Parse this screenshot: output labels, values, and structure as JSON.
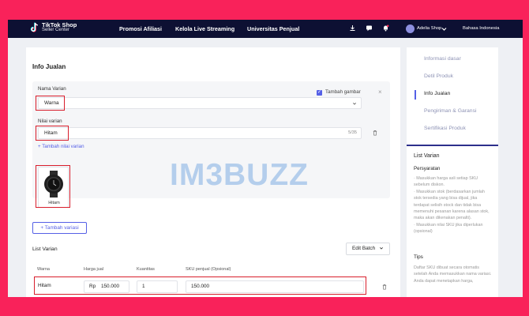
{
  "topbar": {
    "logo_line1": "TikTok Shop",
    "logo_line2": "Seller Center",
    "nav": [
      "Promosi Afiliasi",
      "Kelola Live Streaming",
      "Universitas Penjual"
    ],
    "shop_name": "Adelia Shop",
    "language": "Bahasa Indonesia",
    "icons": [
      "download-icon",
      "chat-icon",
      "bell-icon",
      "avatar",
      "chevron-down-icon"
    ]
  },
  "section": {
    "title": "Info Jualan"
  },
  "variant": {
    "name_label": "Nama Varian",
    "name_value": "Warna",
    "add_image_label": "Tambah gambar",
    "add_image_checked": true,
    "value_label": "Nilai varian",
    "value_value": "Hitam",
    "value_counter": "5/35",
    "add_value_link": "+ Tambah nilai varian",
    "image_caption": "Hitam",
    "add_variation_button": "+ Tambah variasi"
  },
  "list": {
    "title": "List Varian",
    "edit_batch": "Edit Batch",
    "headers": [
      "Warna",
      "Harga jual",
      "Kuantitas",
      "SKU penjual (Opsional)"
    ],
    "row": {
      "color": "Hitam",
      "currency": "Rp",
      "price": "150.000",
      "quantity": "1",
      "sku": "150.000"
    }
  },
  "steps": {
    "items": [
      "Informasi dasar",
      "Detil Produk",
      "Info Jualan",
      "Pengiriman & Garansi",
      "Sertifikasi Produk"
    ],
    "active_index": 2
  },
  "help": {
    "title": "List Varian",
    "req_title": "Persyaratan",
    "req_1": "· Masukkan harga asli setiap SKU sebelum diskon.",
    "req_2": "· Masukkan stok (berdasarkan jumlah stok tersedia yang bisa dijual, jika terdapat selisih stock dan tidak bisa memenuhi pesanan karena alasan stok, maka akan dikenakan penalti).",
    "req_3": "· Masukkan nilai SKU jika diperlukan (opsional)",
    "tips_title": "Tips",
    "tips_1": "Daftar SKU dibuat secara otomatis setelah Anda memasukkan nama variasi. Anda dapat menetapkan harga,"
  },
  "watermark": "IM3BUZZ",
  "colors": {
    "background": "#f9225a",
    "topbar": "#0d1033",
    "accent": "#5560e6",
    "highlight": "#d81e2c"
  }
}
